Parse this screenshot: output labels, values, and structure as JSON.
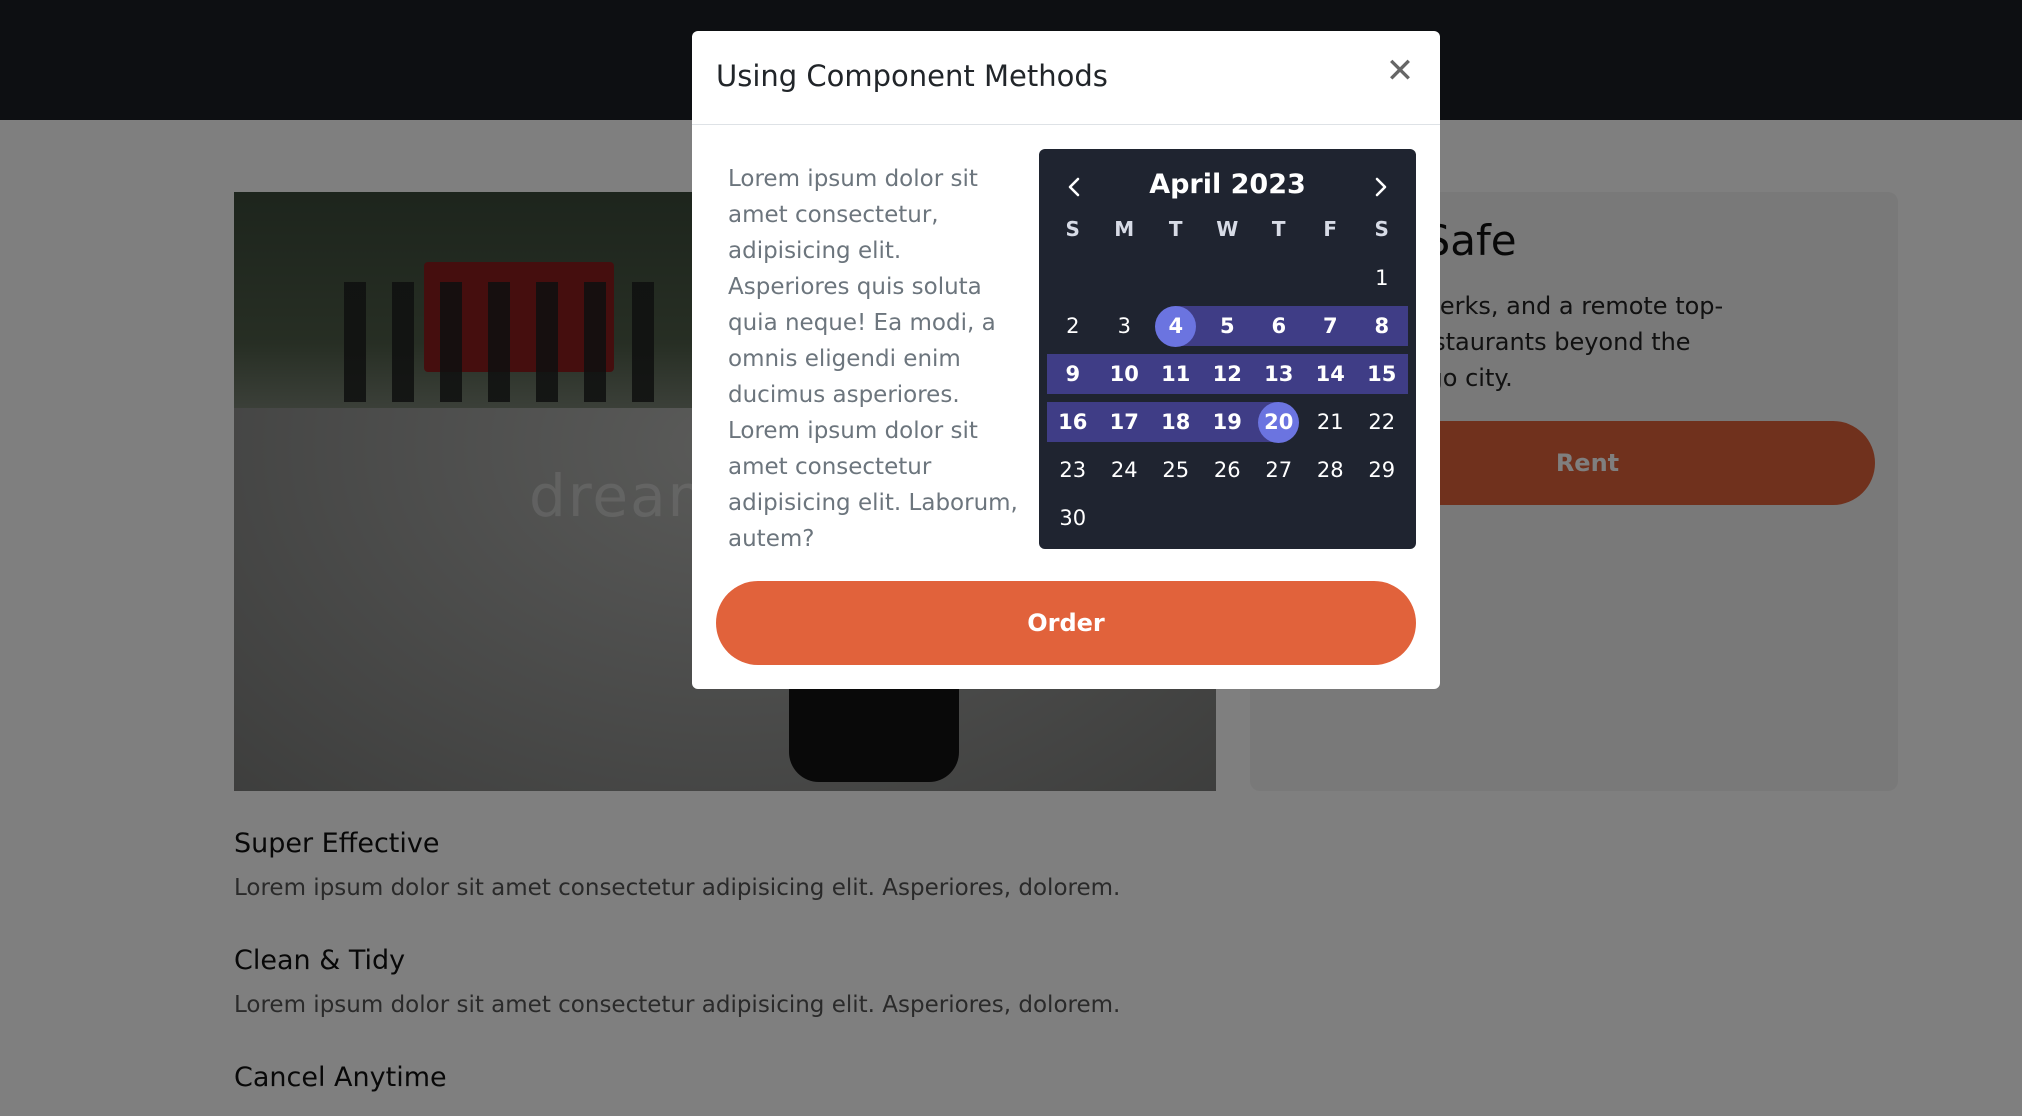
{
  "modal": {
    "title": "Using Component Methods",
    "close_icon": "close-icon",
    "body_text": "Lorem ipsum dolor sit amet consectetur, adipisicing elit. Asperiores quis soluta quia neque! Ea modi, a omnis eligendi enim ducimus asperiores. Lorem ipsum dolor sit amet consectetur adipisicing elit. Laborum, autem?",
    "order_label": "Order"
  },
  "calendar": {
    "month_label": "April 2023",
    "weekdays": [
      "S",
      "M",
      "T",
      "W",
      "T",
      "F",
      "S"
    ],
    "weeks": [
      [
        "",
        "",
        "",
        "",
        "",
        "",
        "1"
      ],
      [
        "2",
        "3",
        "4",
        "5",
        "6",
        "7",
        "8"
      ],
      [
        "9",
        "10",
        "11",
        "12",
        "13",
        "14",
        "15"
      ],
      [
        "16",
        "17",
        "18",
        "19",
        "20",
        "21",
        "22"
      ],
      [
        "23",
        "24",
        "25",
        "26",
        "27",
        "28",
        "29"
      ],
      [
        "30",
        "",
        "",
        "",
        "",
        "",
        ""
      ]
    ],
    "range_start": "4",
    "range_end": "20",
    "colors": {
      "background": "#1f2430",
      "range": "#3f3d86",
      "endpoint": "#6b74e0"
    }
  },
  "card": {
    "title_visible": "ble & Safe",
    "text_lines": [
      "beach, its perks, and a remote top-",
      "uty of at restaurants beyond the",
      "weekends go city."
    ],
    "rent_label": "Rent"
  },
  "hero": {
    "watermark": "dream"
  },
  "features": [
    {
      "title": "Super Effective",
      "text": "Lorem ipsum dolor sit amet consectetur adipisicing elit. Asperiores, dolorem."
    },
    {
      "title": "Clean & Tidy",
      "text": "Lorem ipsum dolor sit amet consectetur adipisicing elit. Asperiores, dolorem."
    },
    {
      "title": "Cancel Anytime",
      "text": ""
    }
  ],
  "colors": {
    "accent": "#e1623b",
    "topbar": "#1b1f24"
  }
}
